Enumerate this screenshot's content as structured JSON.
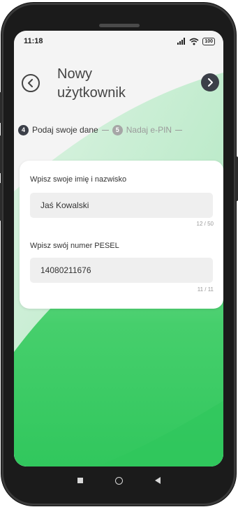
{
  "status_bar": {
    "time": "11:18",
    "battery": "100",
    "icons": [
      "signal-icon",
      "wifi-icon",
      "battery-icon"
    ]
  },
  "header": {
    "title_line1": "Nowy",
    "title_line2": "użytkownik",
    "back_icon": "chevron-left-icon",
    "next_icon": "chevron-right-icon"
  },
  "steps": [
    {
      "number": "4",
      "label": "Podaj swoje dane",
      "active": true
    },
    {
      "number": "5",
      "label": "Nadaj e-PIN",
      "active": false
    }
  ],
  "form": {
    "name": {
      "label": "Wpisz swoje imię i nazwisko",
      "value": "Jaś Kowalski",
      "counter": "12 / 50"
    },
    "pesel": {
      "label": "Wpisz swój numer PESEL",
      "value": "14080211676",
      "counter": "11 / 11"
    }
  },
  "colors": {
    "accent_dark": "#3b3f48",
    "green": "#3ecb64",
    "green_light": "#b9ecc6"
  },
  "nav_bar": [
    "recent-apps-icon",
    "home-icon",
    "back-icon"
  ]
}
